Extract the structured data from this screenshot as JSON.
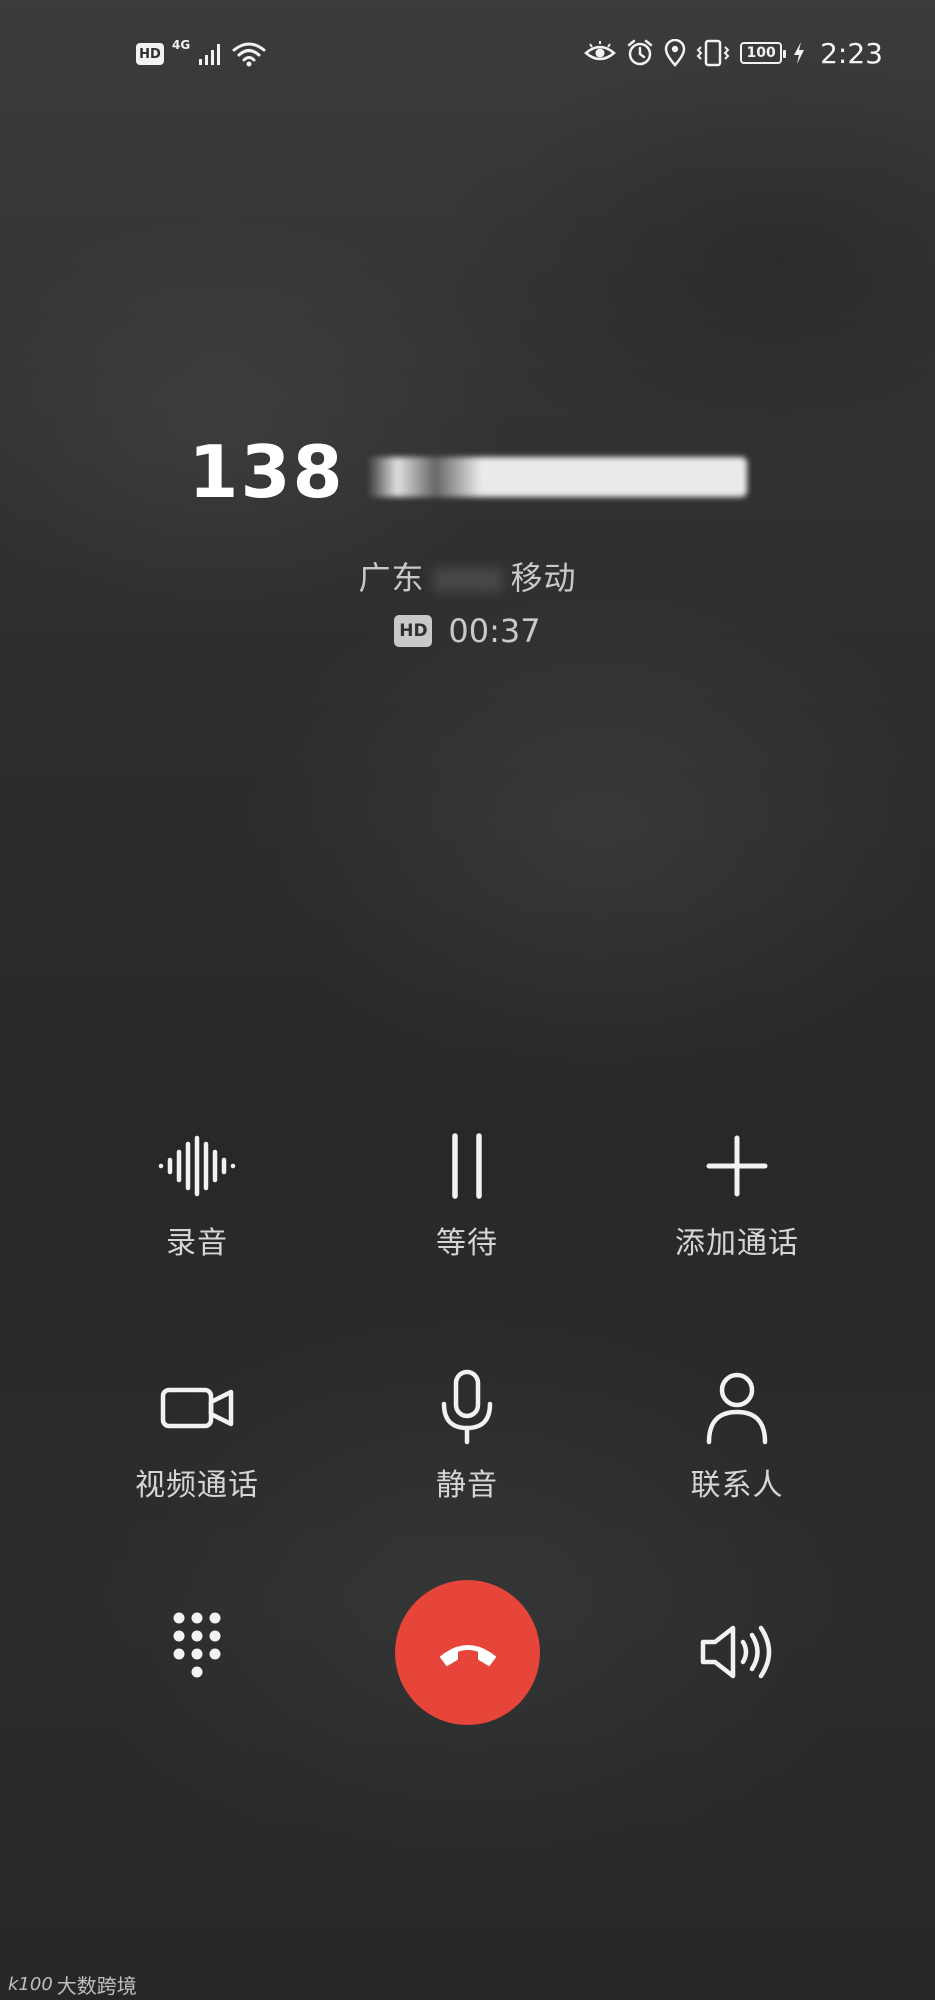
{
  "status_bar": {
    "hd": "HD",
    "network": "4G",
    "battery": "100",
    "time": "2:23",
    "icons": [
      "hd-icon",
      "signal-icon",
      "wifi-icon",
      "eye-comfort-icon",
      "alarm-icon",
      "location-icon",
      "vibrate-icon",
      "battery-icon",
      "charging-icon"
    ]
  },
  "caller": {
    "number_visible": "138",
    "location_left": "广东",
    "location_right": "移动",
    "hd_badge": "HD",
    "duration": "00:37"
  },
  "actions": {
    "record": {
      "label": "录音",
      "icon": "waveform-icon"
    },
    "hold": {
      "label": "等待",
      "icon": "pause-icon"
    },
    "add_call": {
      "label": "添加通话",
      "icon": "plus-icon"
    },
    "video_call": {
      "label": "视频通话",
      "icon": "video-camera-icon"
    },
    "mute": {
      "label": "静音",
      "icon": "microphone-icon"
    },
    "contacts": {
      "label": "联系人",
      "icon": "person-icon"
    }
  },
  "bottom": {
    "dialpad_icon": "dialpad-icon",
    "hangup_icon": "hang-up-icon",
    "speaker_icon": "speaker-icon",
    "hangup_color": "#e8453a"
  },
  "watermark": {
    "logo": "k100",
    "text": "大数跨境"
  }
}
